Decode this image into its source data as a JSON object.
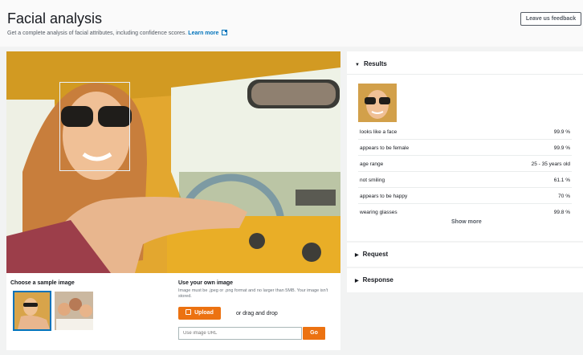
{
  "header": {
    "title": "Facial analysis",
    "subtitle": "Get a complete analysis of facial attributes, including confidence scores.",
    "learn_more": "Learn more",
    "feedback_label": "Leave us feedback"
  },
  "sample": {
    "label": "Choose a sample image"
  },
  "own_image": {
    "label": "Use your own image",
    "hint": "Image must be .jpeg or .png format and no larger than 5MB. Your image isn't stored.",
    "upload_label": "Upload",
    "drag_text": "or drag and drop",
    "url_placeholder": "Use image URL",
    "go_label": "Go"
  },
  "results": {
    "title": "Results",
    "attributes": [
      {
        "name": "looks like a face",
        "value": "99.9 %"
      },
      {
        "name": "appears to be female",
        "value": "99.9 %"
      },
      {
        "name": "age range",
        "value": "25 - 35 years old"
      },
      {
        "name": "not smiling",
        "value": "61.1 %"
      },
      {
        "name": "appears to be happy",
        "value": "70 %"
      },
      {
        "name": "wearing glasses",
        "value": "99.8 %"
      }
    ],
    "show_more": "Show more"
  },
  "request": {
    "title": "Request"
  },
  "response": {
    "title": "Response"
  },
  "colors": {
    "accent": "#ec7211",
    "link": "#0073bb",
    "selected_border": "#0073bb"
  }
}
